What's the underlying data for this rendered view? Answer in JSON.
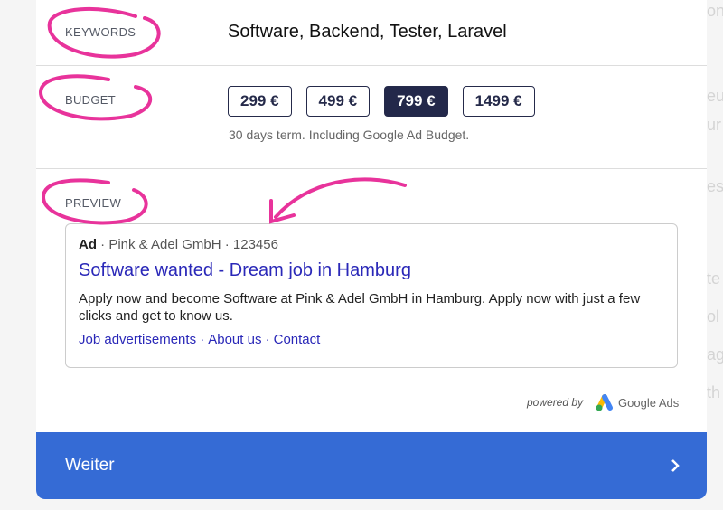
{
  "background_fragments": [
    "ons",
    "eu",
    "ur",
    "es",
    "te",
    "ol",
    "ag",
    "th"
  ],
  "keywords": {
    "label": "KEYWORDS",
    "value": "Software, Backend, Tester, Laravel"
  },
  "budget": {
    "label": "BUDGET",
    "options": [
      "299 €",
      "499 €",
      "799 €",
      "1499 €"
    ],
    "selected": "799 €",
    "note": "30 days term. Including Google Ad Budget."
  },
  "preview": {
    "label": "PREVIEW",
    "ad": {
      "badge": "Ad",
      "advertiser": "· Pink & Adel GmbH ·",
      "phone": "123456",
      "title": "Software wanted - Dream job in Hamburg",
      "description": "Apply now and become Software at Pink & Adel GmbH in Hamburg. Apply now with just a few clicks and get to know us.",
      "links": [
        "Job advertisements ·",
        "About us ·",
        "Contact"
      ]
    },
    "powered_by": "powered by",
    "brand": "Google Ads"
  },
  "footer": {
    "label": "Weiter",
    "icon": "chevron-right-icon"
  },
  "colors": {
    "accent": "#356bd5",
    "selected": "#23284a",
    "link": "#2a28b8",
    "annotation": "#e8339b"
  }
}
